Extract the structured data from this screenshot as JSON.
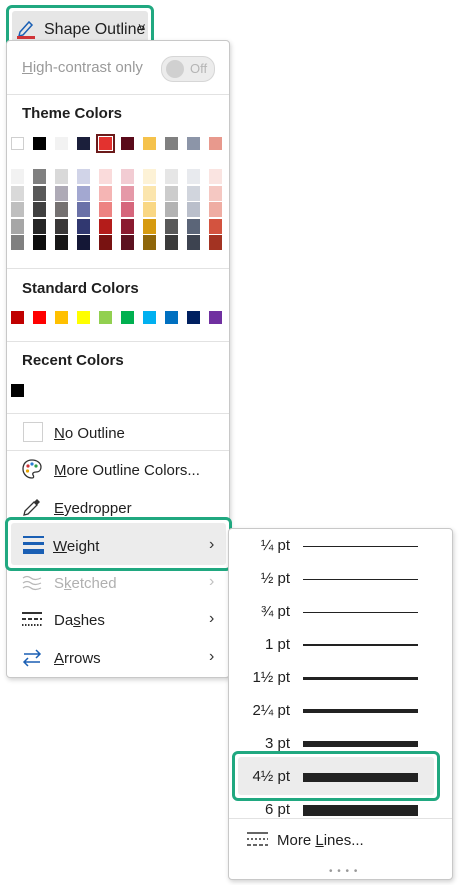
{
  "button": {
    "label": "Shape Outline",
    "chevron": "˅",
    "icon": "pen-outline-icon",
    "accent": "#d13438"
  },
  "menu": {
    "high_contrast_label": "High-contrast only",
    "toggle_label": "Off",
    "theme_header": "Theme Colors",
    "theme_top": [
      "#ffffff",
      "#000000",
      "#f2f2f2",
      "#1b1f3b",
      "#e3322f",
      "#5a0a1a",
      "#f5c24c",
      "#808080",
      "#8c95a8",
      "#e8998d"
    ],
    "theme_shades": [
      [
        "#f2f2f2",
        "#d9d9d9",
        "#bfbfbf",
        "#a6a6a6",
        "#808080"
      ],
      [
        "#808080",
        "#595959",
        "#404040",
        "#262626",
        "#0d0d0d"
      ],
      [
        "#d9d9d9",
        "#aeaab6",
        "#757171",
        "#3a3838",
        "#171616"
      ],
      [
        "#d1d4e8",
        "#a3a8d1",
        "#6a71a8",
        "#313870",
        "#141736"
      ],
      [
        "#fadbdb",
        "#f5b5b4",
        "#ed8382",
        "#b41c1a",
        "#781211"
      ],
      [
        "#f2ccd3",
        "#e599a8",
        "#d6667c",
        "#8a1a30",
        "#5c1120"
      ],
      [
        "#fdf2d6",
        "#fbe5ad",
        "#f9d784",
        "#d69a0f",
        "#8f660a"
      ],
      [
        "#e6e6e6",
        "#cccccc",
        "#b3b3b3",
        "#595959",
        "#3b3b3b"
      ],
      [
        "#e8eaee",
        "#d1d5dd",
        "#babfcb",
        "#5b6578",
        "#3d4350"
      ],
      [
        "#fae4e1",
        "#f5c8c2",
        "#efada3",
        "#d3533f",
        "#a33322"
      ]
    ],
    "standard_header": "Standard Colors",
    "standard": [
      "#c00000",
      "#ff0000",
      "#ffc000",
      "#ffff00",
      "#92d050",
      "#00b050",
      "#00b0f0",
      "#0070c0",
      "#002060",
      "#7030a0"
    ],
    "recent_header": "Recent Colors",
    "recent": [
      "#000000"
    ],
    "items": {
      "no_outline": {
        "pre": "",
        "u": "N",
        "post": "o Outline"
      },
      "more_colors": {
        "pre": "",
        "u": "M",
        "post": "ore Outline Colors..."
      },
      "eyedropper": {
        "pre": "",
        "u": "E",
        "post": "yedropper"
      },
      "weight": {
        "pre": "",
        "u": "W",
        "post": "eight"
      },
      "sketched": {
        "pre": "S",
        "u": "k",
        "post": "etched"
      },
      "dashes": {
        "pre": "Da",
        "u": "s",
        "post": "hes"
      },
      "arrows": {
        "pre": "",
        "u": "A",
        "post": "rrows"
      }
    },
    "arrow_glyph": "›"
  },
  "submenu": {
    "weights": [
      {
        "label": "¼ pt",
        "pt": 0.25
      },
      {
        "label": "½ pt",
        "pt": 0.5
      },
      {
        "label": "¾ pt",
        "pt": 0.75
      },
      {
        "label": "1 pt",
        "pt": 1
      },
      {
        "label": "1½ pt",
        "pt": 1.5
      },
      {
        "label": "2¼ pt",
        "pt": 2.25
      },
      {
        "label": "3 pt",
        "pt": 3
      },
      {
        "label": "4½ pt",
        "pt": 4.5
      },
      {
        "label": "6 pt",
        "pt": 6
      }
    ],
    "selected_label": "4½ pt",
    "more_lines": {
      "pre": "More ",
      "u": "L",
      "post": "ines..."
    }
  }
}
